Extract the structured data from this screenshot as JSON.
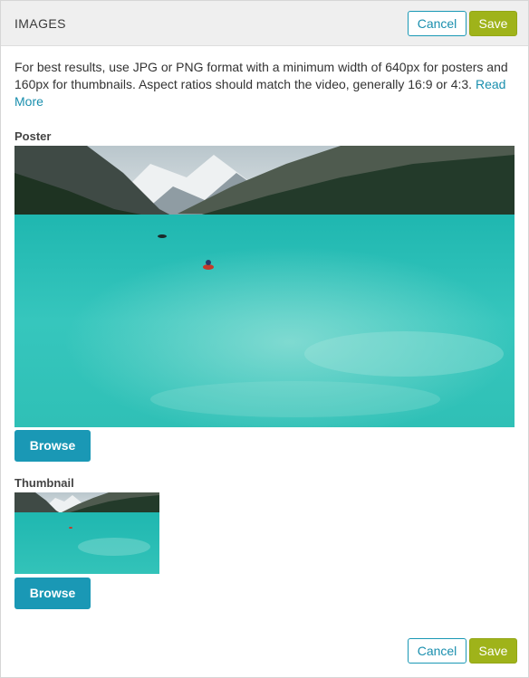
{
  "header": {
    "title": "IMAGES",
    "cancel_label": "Cancel",
    "save_label": "Save"
  },
  "intro": {
    "text": "For best results, use JPG or PNG format with a minimum width of 640px for posters and 160px for thumbnails. Aspect ratios should match the video, generally 16:9 or 4:3.",
    "read_more_label": "Read More"
  },
  "poster": {
    "label": "Poster",
    "browse_label": "Browse"
  },
  "thumbnail": {
    "label": "Thumbnail",
    "browse_label": "Browse"
  },
  "footer": {
    "cancel_label": "Cancel",
    "save_label": "Save"
  },
  "colors": {
    "accent_teal": "#1a98b5",
    "save_green": "#9fb31a",
    "header_bg": "#efefef"
  }
}
